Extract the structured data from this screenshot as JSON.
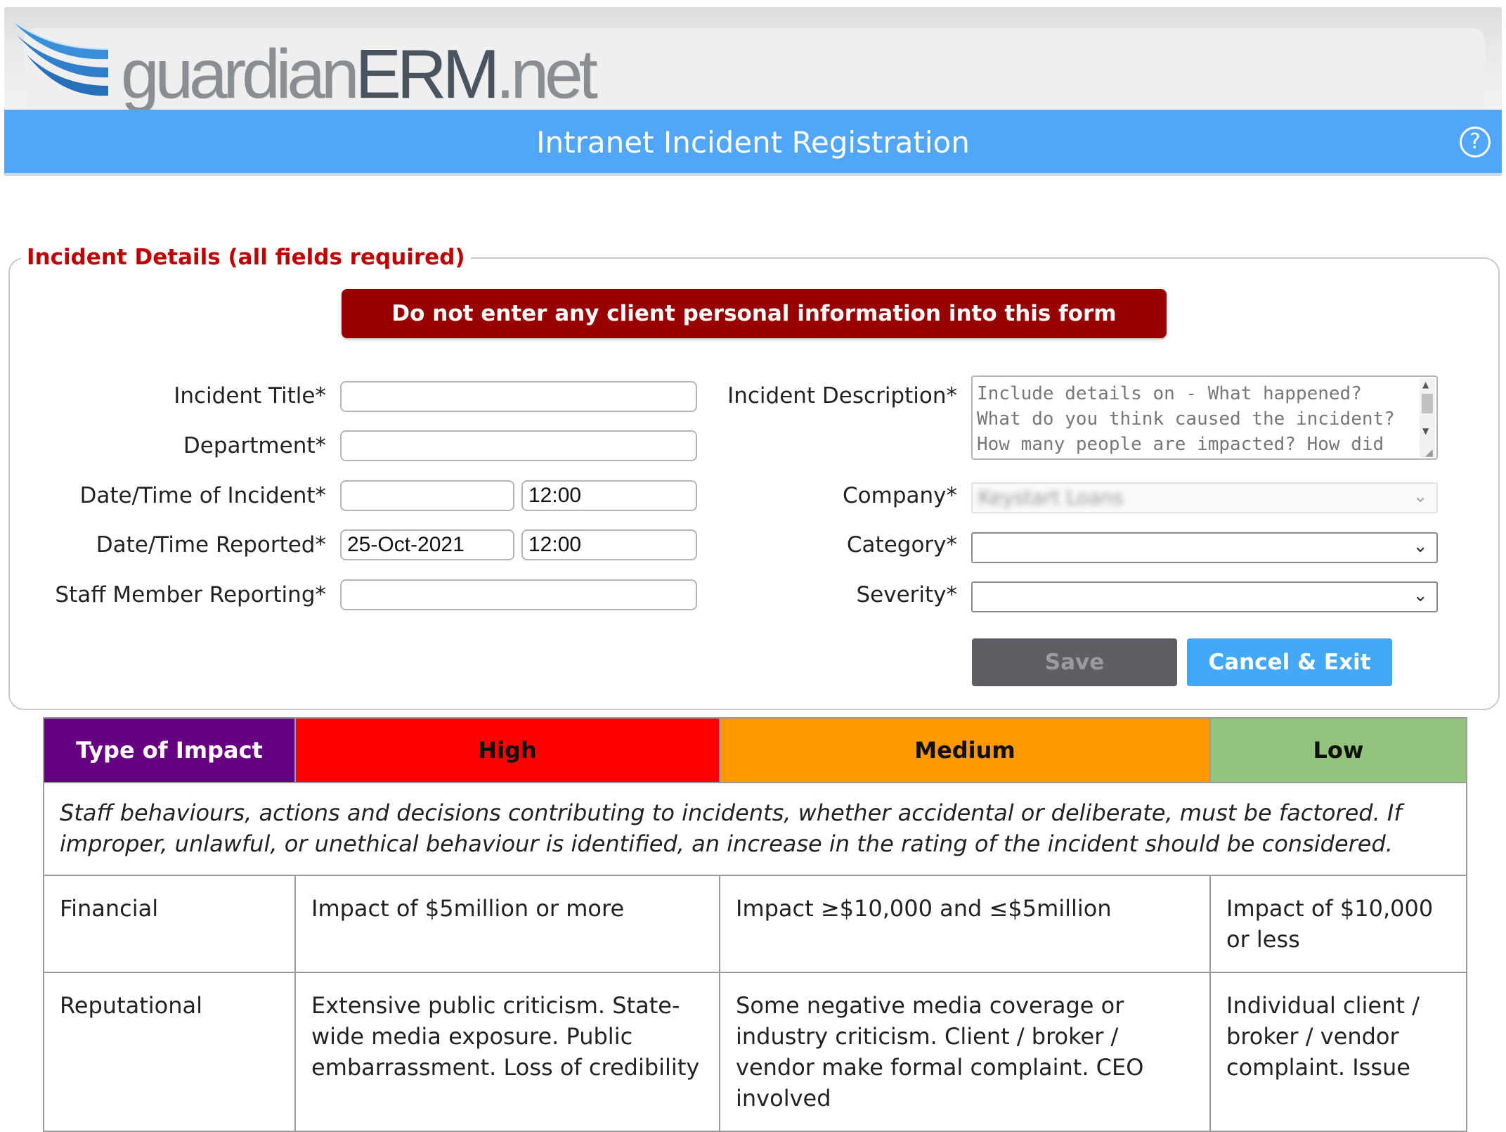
{
  "app": {
    "logo_text_light": "guardian",
    "logo_text_dark": "ERM",
    "logo_text_suffix": ".net",
    "title": "Intranet Incident Registration",
    "help_symbol": "?"
  },
  "colors": {
    "title_bar": "#52a6f8",
    "warning_bg": "#990000",
    "legend_text": "#c00000",
    "save_bg": "#5e5f65",
    "cancel_bg": "#43a8f6",
    "type_of_impact": "#660080",
    "high": "#ff0000",
    "medium": "#ff9900",
    "low": "#93c47d"
  },
  "form": {
    "legend": "Incident Details (all fields required)",
    "warning": "Do not enter any client personal information into this form",
    "left_fields": {
      "incident_title": {
        "label": "Incident Title*",
        "value": ""
      },
      "department": {
        "label": "Department*",
        "value": ""
      },
      "date_time_incident": {
        "label": "Date/Time of Incident*",
        "date": "",
        "time": "12:00"
      },
      "date_time_reported": {
        "label": "Date/Time Reported*",
        "date": "25-Oct-2021",
        "time": "12:00"
      },
      "staff_member": {
        "label": "Staff Member Reporting*",
        "value": ""
      }
    },
    "right_fields": {
      "description": {
        "label": "Incident Description*",
        "placeholder": "Include details on - What happened? What do you think caused the incident? How many people are impacted? How did"
      },
      "company": {
        "label": "Company*",
        "value": "Keystart Loans"
      },
      "category": {
        "label": "Category*",
        "value": ""
      },
      "severity": {
        "label": "Severity*",
        "value": ""
      }
    },
    "buttons": {
      "save": "Save",
      "cancel": "Cancel & Exit"
    }
  },
  "impact_table": {
    "headers": {
      "type": "Type of Impact",
      "high": "High",
      "medium": "Medium",
      "low": "Low"
    },
    "note": "Staff behaviours, actions and decisions contributing to incidents, whether accidental or deliberate, must be factored. If improper, unlawful, or unethical behaviour is identified, an increase in the rating of the incident should be considered.",
    "rows": [
      {
        "type": "Financial",
        "high": "Impact of $5million or more",
        "medium": "Impact ≥$10,000 and ≤$5million",
        "low": "Impact of $10,000 or less"
      },
      {
        "type": "Reputational",
        "high": "Extensive public criticism. State-wide media exposure. Public embarrassment. Loss of credibility",
        "medium": "Some negative media coverage or industry criticism. Client / broker / vendor make formal complaint. CEO involved",
        "low": "Individual client / broker / vendor complaint. Issue"
      }
    ]
  }
}
